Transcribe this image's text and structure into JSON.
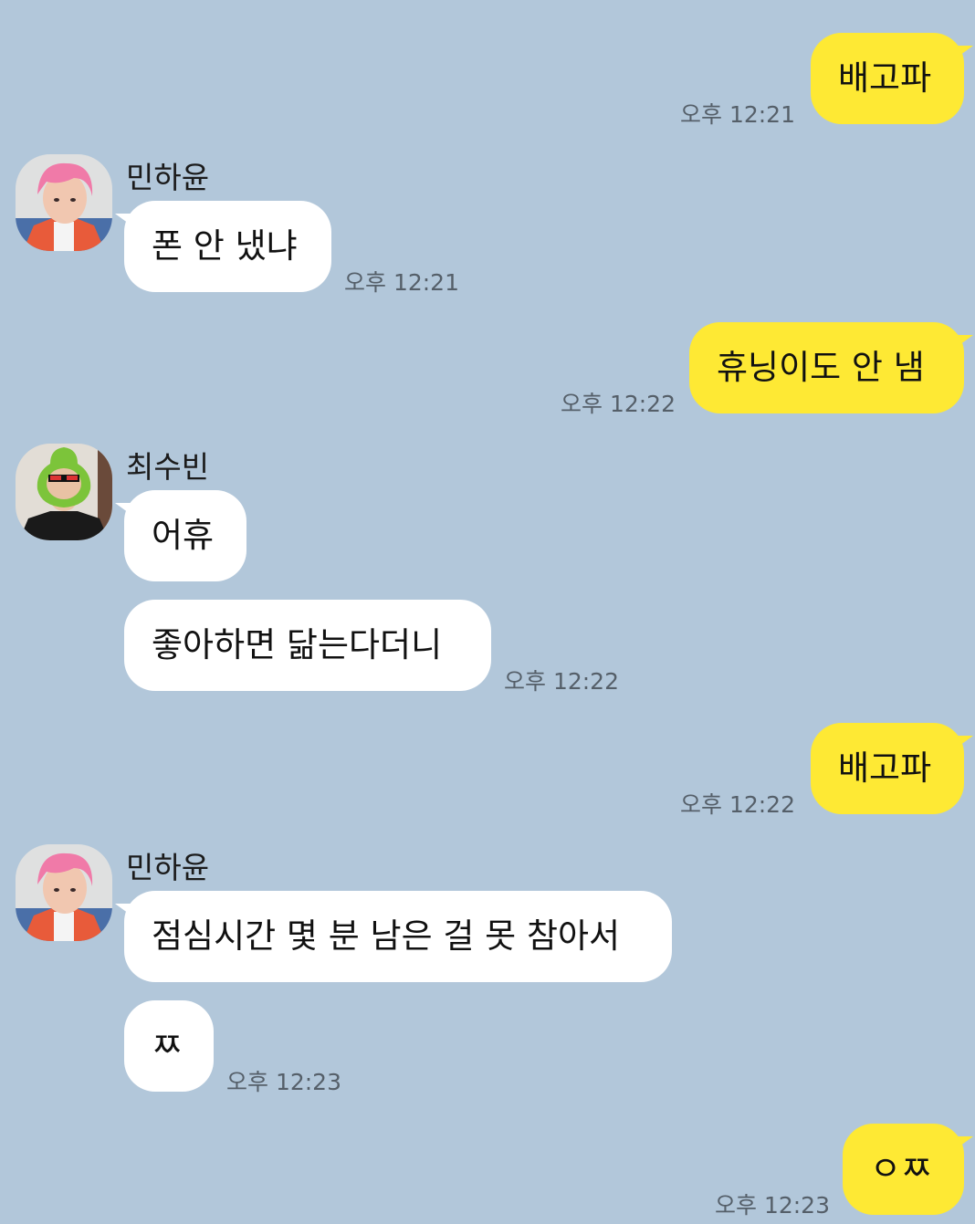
{
  "messages": {
    "m1": {
      "text": "배고파",
      "time": "오후 12:21"
    },
    "m2": {
      "sender": "민하윤",
      "text": "폰 안 냈냐",
      "time": "오후 12:21"
    },
    "m3": {
      "text": "휴닝이도 안 냄",
      "time": "오후 12:22"
    },
    "m4": {
      "sender": "최수빈",
      "text": "어휴"
    },
    "m5": {
      "text": "좋아하면 닮는다더니",
      "time": "오후 12:22"
    },
    "m6": {
      "text": "배고파",
      "time": "오후 12:22"
    },
    "m7": {
      "sender": "민하윤",
      "text": "점심시간 몇 분 남은 걸 못 참아서"
    },
    "m8": {
      "text": "ㅉ",
      "time": "오후 12:23"
    },
    "m9": {
      "text": "ㅇㅉ",
      "time": "오후 12:23"
    }
  },
  "colors": {
    "background": "#b2c7da",
    "outgoing_bubble": "#fee934",
    "incoming_bubble": "#ffffff"
  }
}
